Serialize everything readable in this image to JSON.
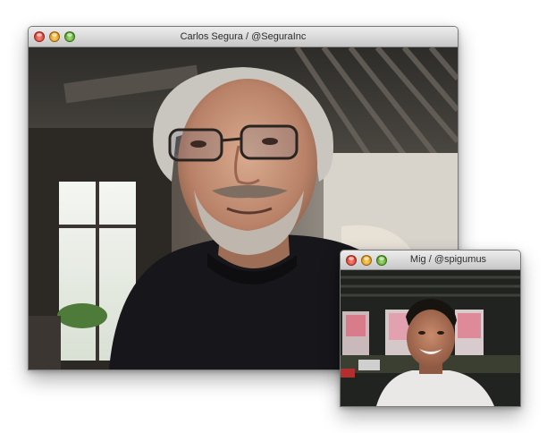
{
  "main_window": {
    "title": "Carlos Segura / @SeguraInc"
  },
  "pip_window": {
    "title": "Mig / @spigumus"
  },
  "colors": {
    "close_light": "#d63a2a",
    "minimize_light": "#dc9213",
    "zoom_light": "#4f9f24"
  },
  "icons": [
    "close-button",
    "minimize-button",
    "zoom-button"
  ]
}
